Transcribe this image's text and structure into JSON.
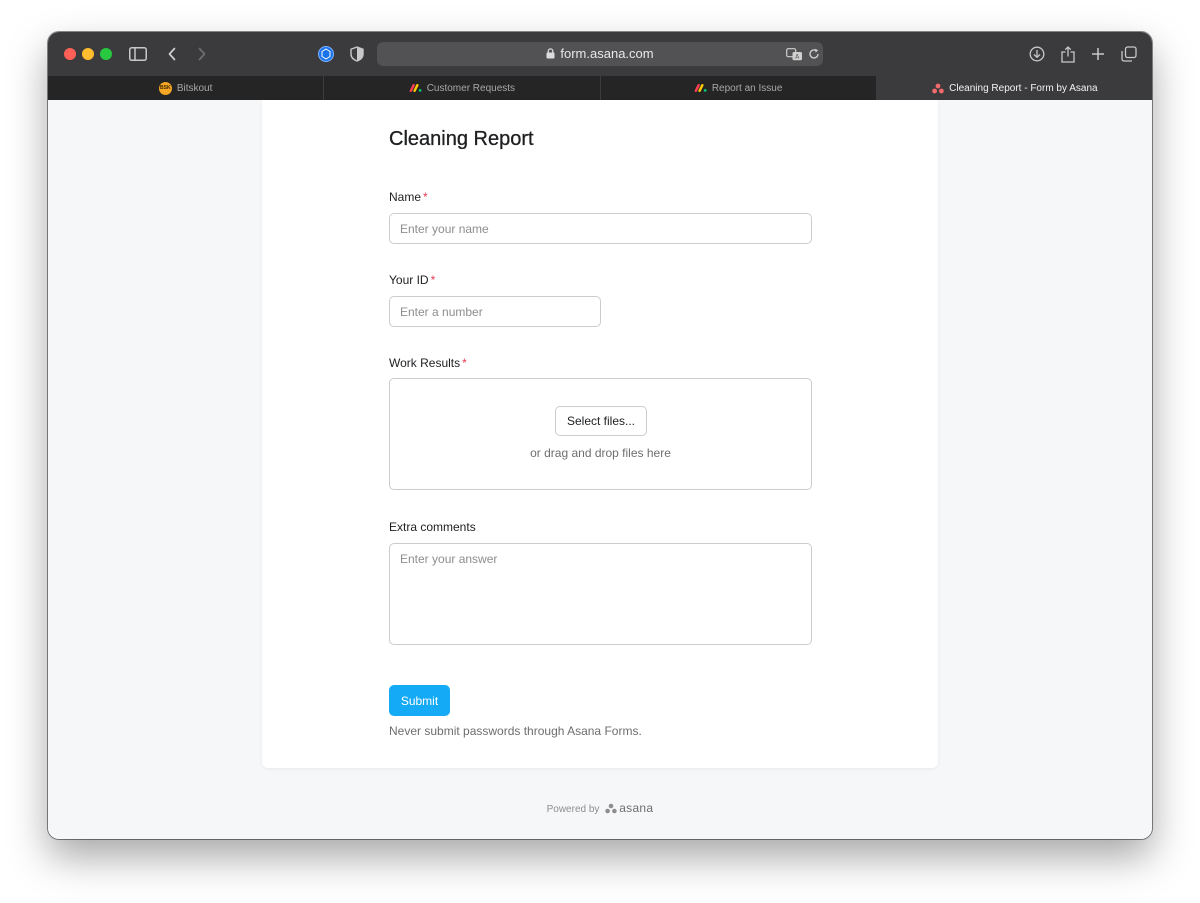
{
  "browser": {
    "url": "form.asana.com",
    "tabs": [
      {
        "label": "Bitskout",
        "favicon": "bitskout-logo-icon",
        "favicon_text": "BSK",
        "active": false
      },
      {
        "label": "Customer Requests",
        "favicon": "monday-logo-icon",
        "active": false
      },
      {
        "label": "Report an Issue",
        "favicon": "monday-logo-icon",
        "active": false
      },
      {
        "label": "Cleaning Report - Form by Asana",
        "favicon": "asana-logo-icon",
        "active": true
      }
    ]
  },
  "form": {
    "title": "Cleaning Report",
    "fields": {
      "name": {
        "label": "Name",
        "required_mark": "*",
        "placeholder": "Enter your name",
        "value": ""
      },
      "your_id": {
        "label": "Your ID",
        "required_mark": "*",
        "placeholder": "Enter a number",
        "value": ""
      },
      "work_results": {
        "label": "Work Results",
        "required_mark": "*",
        "button_label": "Select files...",
        "hint": "or drag and drop files here"
      },
      "extra_comments": {
        "label": "Extra comments",
        "placeholder": "Enter your answer",
        "value": ""
      }
    },
    "submit_label": "Submit",
    "notice": "Never submit passwords through Asana Forms."
  },
  "footer": {
    "powered_by": "Powered by",
    "brand": "asana"
  },
  "colors": {
    "accent": "#14aaf5",
    "required": "#e8384f",
    "asana_coral": "#f06a6a"
  }
}
